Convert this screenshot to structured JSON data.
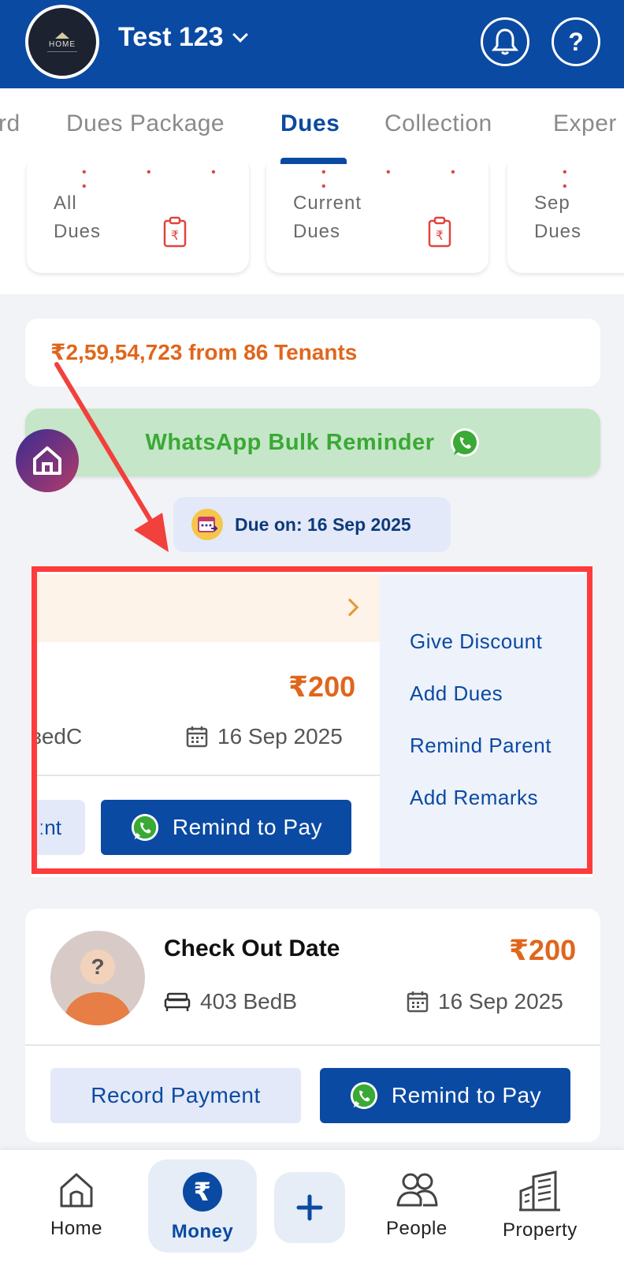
{
  "header": {
    "logo_text": "HOME",
    "property_name": "Test 123"
  },
  "tabs": [
    {
      "label": "rd"
    },
    {
      "label": "Dues Package"
    },
    {
      "label": "Dues",
      "active": true
    },
    {
      "label": "Collection"
    },
    {
      "label": "Exper"
    }
  ],
  "summary_cards": [
    {
      "label": "All\nDues"
    },
    {
      "label": "Current\nDues"
    },
    {
      "label": "Sep\nDues"
    }
  ],
  "total": {
    "text": "₹2,59,54,723 from 86 Tenants"
  },
  "whatsapp_bulk": {
    "label": "WhatsApp Bulk Reminder"
  },
  "due_chip": {
    "label": "Due on: 16 Sep 2025"
  },
  "swiped_card": {
    "amount": "₹200",
    "bed": "ɜedC",
    "date": "16 Sep 2025",
    "record_label": "ːnt",
    "remind_label": "Remind to Pay",
    "actions": [
      "Give Discount",
      "Add Dues",
      "Remind Parent",
      "Add Remarks"
    ]
  },
  "tenant_card": {
    "name": "Check Out Date",
    "amount": "₹200",
    "bed": "403 BedB",
    "date": "16 Sep 2025",
    "record_label": "Record Payment",
    "remind_label": "Remind to Pay"
  },
  "bottom_nav": {
    "home": "Home",
    "money": "Money",
    "people": "People",
    "property": "Property"
  },
  "colors": {
    "primary": "#0b4aa2",
    "accent_orange": "#e0661c",
    "whatsapp_green": "#3aa935",
    "highlight_red": "#ff3b3b"
  }
}
